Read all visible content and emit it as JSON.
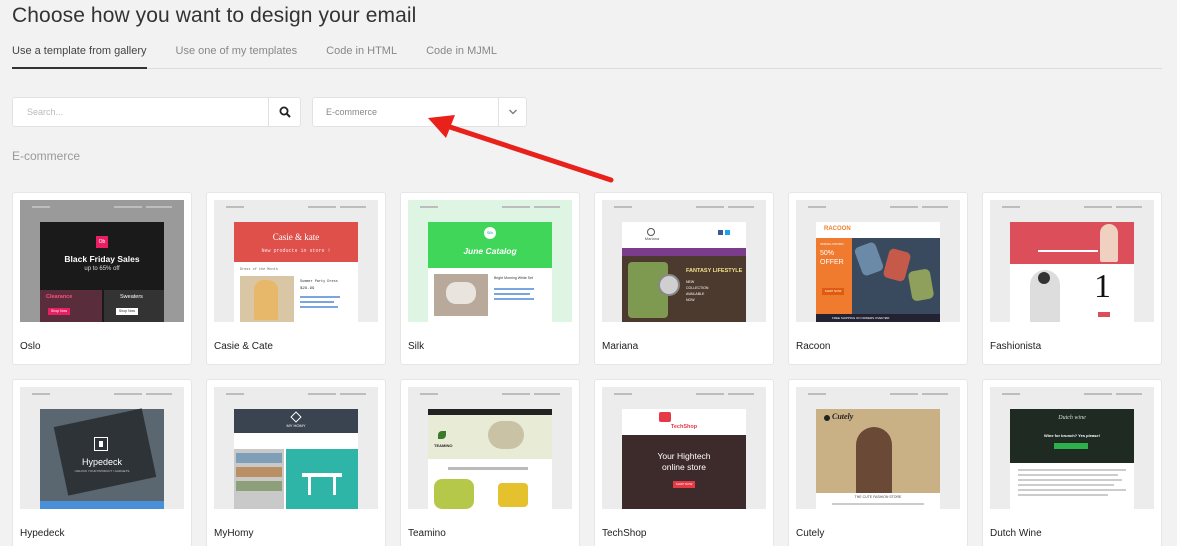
{
  "page": {
    "title": "Choose how you want to design your email",
    "tabs": [
      {
        "label": "Use a template from gallery",
        "active": true
      },
      {
        "label": "Use one of my templates",
        "active": false
      },
      {
        "label": "Code in HTML",
        "active": false
      },
      {
        "label": "Code in MJML",
        "active": false
      }
    ],
    "search": {
      "placeholder": "Search...",
      "icon": "search-icon"
    },
    "category_select": {
      "value": "E-commerce",
      "icon": "chevron-down-icon"
    },
    "section_label": "E-commerce",
    "annotation": {
      "color": "#e8211b",
      "icon": "red-arrow-annotation"
    }
  },
  "templates": [
    {
      "name": "Oslo",
      "thumb": {
        "headline": "Black Friday Sales",
        "sub": "up to 65% off",
        "badge": "Ob",
        "left_label": "Clearance",
        "right_label": "Sweaters",
        "btn_left": "Shop Now",
        "btn_right": "Shop Now"
      }
    },
    {
      "name": "Casie & Cate",
      "thumb": {
        "brand": "Casie & kate",
        "tagline": "New products in store !",
        "section": "Dress of the Month",
        "product": "Summer Party Dress",
        "price": "$29.99"
      }
    },
    {
      "name": "Silk",
      "thumb": {
        "badge": "Silk",
        "headline": "June Catalog",
        "product": "Bright Morning White Set"
      }
    },
    {
      "name": "Mariana",
      "thumb": {
        "brand": "Mariana",
        "headline": "FANTASY LIFESTYLE",
        "body": [
          "NEW",
          "COLLECTION",
          "AVAILABLE",
          "NOW"
        ]
      }
    },
    {
      "name": "Racoon",
      "thumb": {
        "brand": "RACOON",
        "offer_small": "SPRING PROMO",
        "offer": [
          "50%",
          "OFFER"
        ],
        "button": "SHOP NOW",
        "footer": "FREE SHIPPING ON ORDERS OVER $60"
      }
    },
    {
      "name": "Fashionista",
      "thumb": {
        "numeral": "1"
      }
    },
    {
      "name": "Hypedeck",
      "thumb": {
        "brand": "Hypedeck",
        "tagline": "UNLOCK YOUR PRODUCT / GADGETS"
      }
    },
    {
      "name": "MyHomy",
      "thumb": {
        "brand": "MY HOMY"
      }
    },
    {
      "name": "Teamino",
      "thumb": {
        "brand": "TEAMINO"
      }
    },
    {
      "name": "TechShop",
      "thumb": {
        "brand": "TechShop",
        "headline": [
          "Your Hightech",
          "online store"
        ],
        "button": "SHOP NOW"
      }
    },
    {
      "name": "Cutely",
      "thumb": {
        "brand": "Cutely",
        "caption": "THE CUTE FASHION STORE"
      }
    },
    {
      "name": "Dutch Wine",
      "thumb": {
        "brand": "Dutch wine",
        "headline": "Wine for brunch? Yes please!"
      }
    }
  ]
}
